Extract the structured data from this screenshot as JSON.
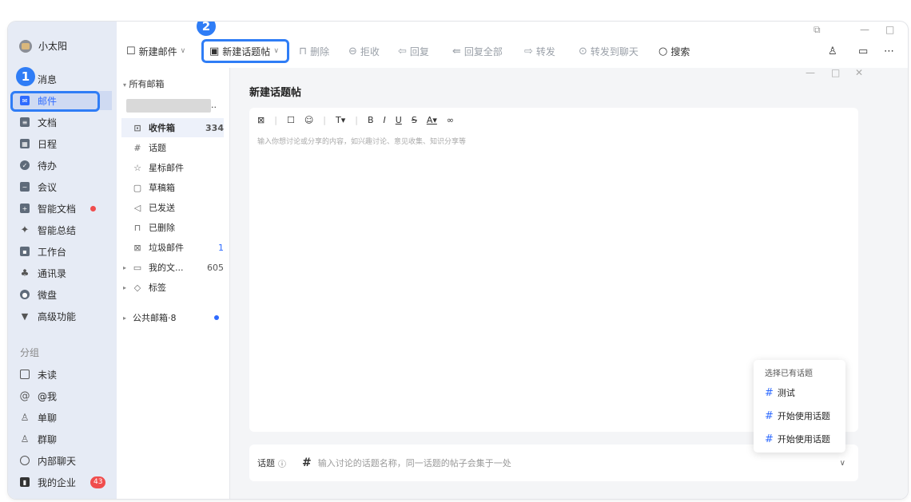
{
  "caption": "",
  "user": {
    "name": "小太阳"
  },
  "nav": {
    "items": [
      {
        "label": "消息",
        "icon": "message-icon"
      },
      {
        "label": "邮件",
        "icon": "mail-icon"
      },
      {
        "label": "文档",
        "icon": "doc-icon"
      },
      {
        "label": "日程",
        "icon": "calendar-icon"
      },
      {
        "label": "待办",
        "icon": "todo-icon"
      },
      {
        "label": "会议",
        "icon": "meeting-icon"
      },
      {
        "label": "智能文档",
        "icon": "smart-doc-icon"
      },
      {
        "label": "智能总结",
        "icon": "sparkle-icon"
      },
      {
        "label": "工作台",
        "icon": "grid-icon"
      },
      {
        "label": "通讯录",
        "icon": "contacts-icon"
      },
      {
        "label": "微盘",
        "icon": "drive-icon"
      },
      {
        "label": "高级功能",
        "icon": "advanced-icon"
      }
    ],
    "group_label": "分组",
    "group_items": [
      {
        "label": "未读",
        "icon": "unread-icon"
      },
      {
        "label": "@我",
        "icon": "at-icon"
      },
      {
        "label": "单聊",
        "icon": "person-icon"
      },
      {
        "label": "群聊",
        "icon": "group-icon"
      },
      {
        "label": "内部聊天",
        "icon": "chat-icon"
      },
      {
        "label": "我的企业",
        "icon": "company-icon",
        "count": "43"
      }
    ]
  },
  "annotations": {
    "step1": "1",
    "step2": "2"
  },
  "toolbar": {
    "new_mail": "新建邮件",
    "new_topic": "新建话题帖",
    "delete": "删除",
    "reject": "拒收",
    "reply": "回复",
    "reply_all": "回复全部",
    "forward": "转发",
    "forward_chat": "转发到聊天",
    "search": "搜索"
  },
  "folders": {
    "header": "所有邮箱",
    "account_suffix": "..",
    "items": [
      {
        "label": "收件箱",
        "count": "334",
        "icon": "inbox-icon"
      },
      {
        "label": "话题",
        "count": "",
        "icon": "hashtag-icon"
      },
      {
        "label": "星标邮件",
        "count": "",
        "icon": "star-icon"
      },
      {
        "label": "草稿箱",
        "count": "",
        "icon": "draft-icon"
      },
      {
        "label": "已发送",
        "count": "",
        "icon": "send-icon"
      },
      {
        "label": "已删除",
        "count": "",
        "icon": "trash-icon"
      },
      {
        "label": "垃圾邮件",
        "count": "1",
        "icon": "spam-icon"
      },
      {
        "label": "我的文...",
        "count": "605",
        "icon": "folder-icon"
      },
      {
        "label": "标签",
        "count": "",
        "icon": "tag-icon"
      }
    ],
    "public": "公共邮箱·8"
  },
  "compose": {
    "title": "新建话题帖",
    "placeholder": "输入你想讨论或分享的内容，如兴趣讨论、意见收集、知识分享等",
    "topic_label": "话题",
    "topic_placeholder": "输入讨论的话题名称，同一话题的帖子会集于一处"
  },
  "popup": {
    "title": "选择已有话题",
    "items": [
      "测试",
      "开始使用话题",
      "开始使用话题"
    ]
  },
  "colors": {
    "accent": "#2f6bff",
    "annotation": "#2f7df6",
    "badge": "#f04d4d"
  }
}
